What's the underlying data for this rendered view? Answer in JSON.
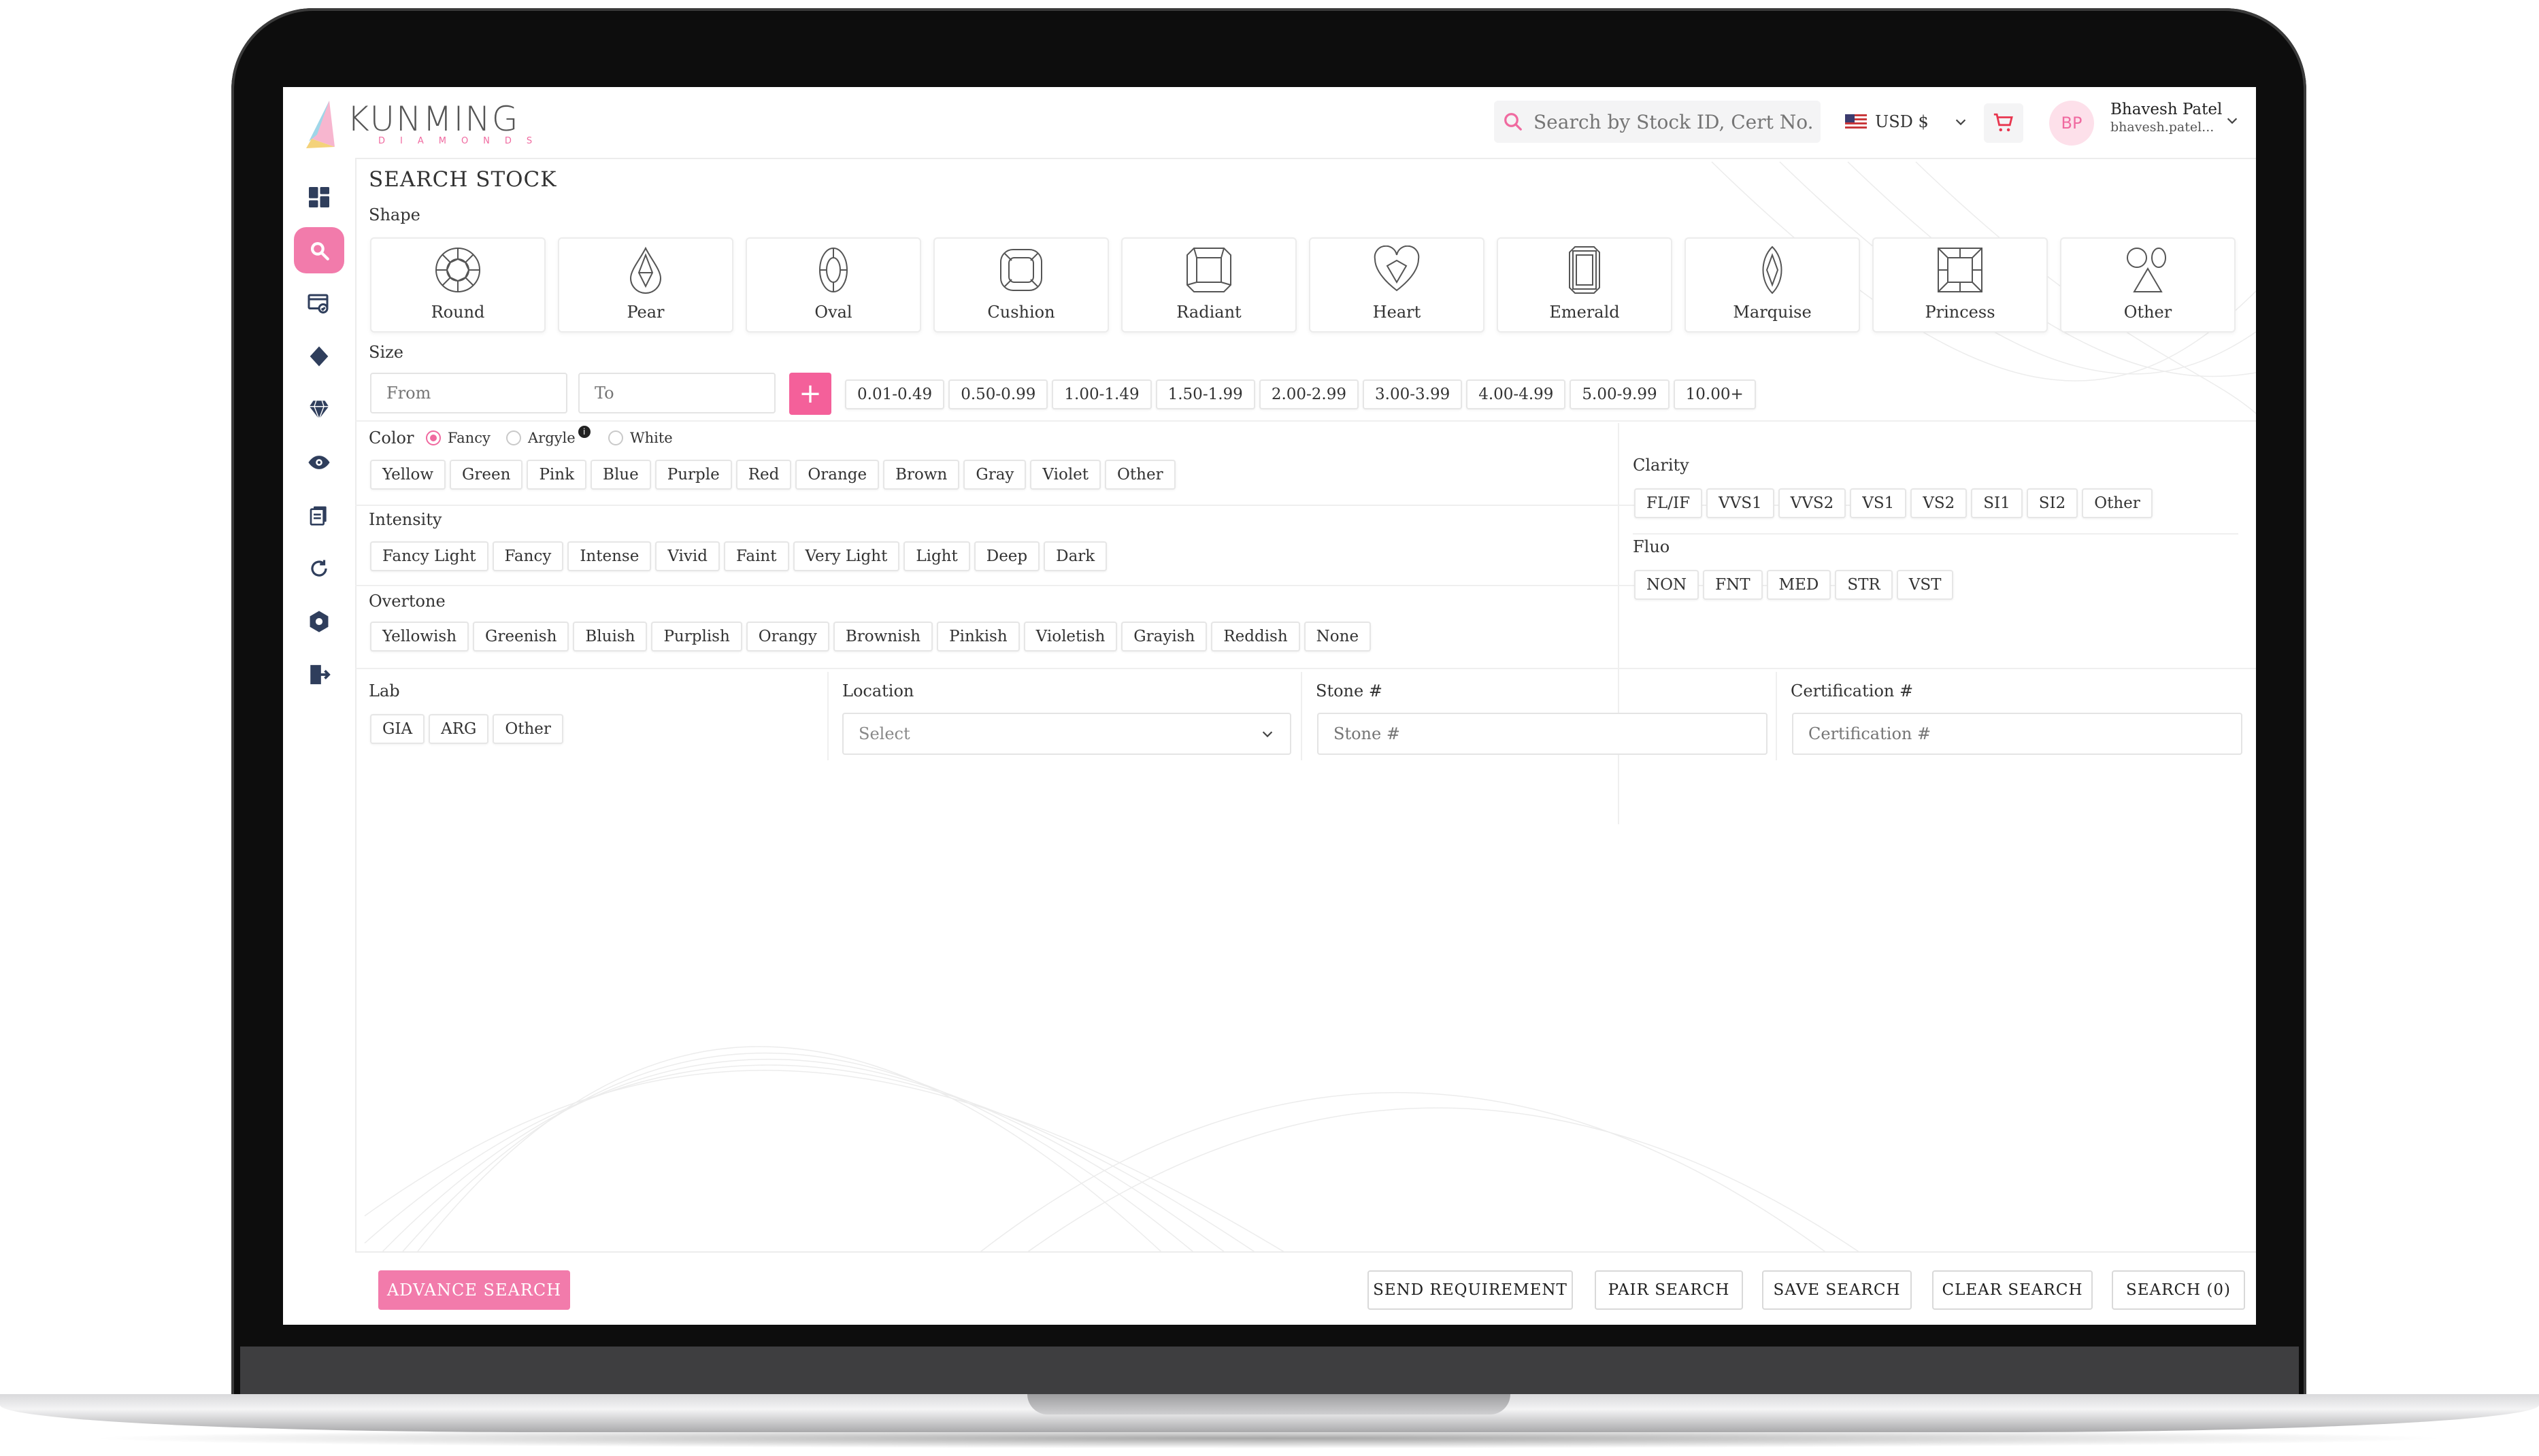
{
  "app": {
    "logo_name": "KUNMING",
    "logo_sub": "DIAMONDS"
  },
  "header": {
    "search_placeholder": "Search by Stock ID, Cert No.",
    "currency": "USD $",
    "avatar_initials": "BP",
    "user_name": "Bhavesh Patel",
    "user_email": "bhavesh.patel..."
  },
  "sidebar": {
    "icons": [
      "dashboard-icon",
      "search-icon",
      "cart-list-icon",
      "diamond-icon",
      "gem-icon",
      "eye-icon",
      "documents-icon",
      "refresh-icon",
      "settings-icon",
      "logout-icon",
      "menu-icon"
    ],
    "active": "search-icon"
  },
  "page": {
    "title": "SEARCH STOCK",
    "shape_label": "Shape",
    "size_label": "Size",
    "color_label": "Color",
    "intensity_label": "Intensity",
    "overtone_label": "Overtone",
    "clarity_label": "Clarity",
    "fluo_label": "Fluo",
    "lab_label": "Lab",
    "location_label": "Location",
    "stone_label": "Stone #",
    "cert_label": "Certification #"
  },
  "shapes": [
    "Round",
    "Pear",
    "Oval",
    "Cushion",
    "Radiant",
    "Heart",
    "Emerald",
    "Marquise",
    "Princess",
    "Other"
  ],
  "size": {
    "from_placeholder": "From",
    "to_placeholder": "To",
    "add_label": "+",
    "ranges": [
      "0.01-0.49",
      "0.50-0.99",
      "1.00-1.49",
      "1.50-1.99",
      "2.00-2.99",
      "3.00-3.99",
      "4.00-4.99",
      "5.00-9.99",
      "10.00+"
    ]
  },
  "color_modes": {
    "options": [
      "Fancy",
      "Argyle",
      "White"
    ],
    "selected": "Fancy",
    "info": "i"
  },
  "colors": [
    "Yellow",
    "Green",
    "Pink",
    "Blue",
    "Purple",
    "Red",
    "Orange",
    "Brown",
    "Gray",
    "Violet",
    "Other"
  ],
  "intensities": [
    "Fancy Light",
    "Fancy",
    "Intense",
    "Vivid",
    "Faint",
    "Very Light",
    "Light",
    "Deep",
    "Dark"
  ],
  "overtones": [
    "Yellowish",
    "Greenish",
    "Bluish",
    "Purplish",
    "Orangy",
    "Brownish",
    "Pinkish",
    "Violetish",
    "Grayish",
    "Reddish",
    "None"
  ],
  "clarity": [
    "FL/IF",
    "VVS1",
    "VVS2",
    "VS1",
    "VS2",
    "SI1",
    "SI2",
    "Other"
  ],
  "fluo": [
    "NON",
    "FNT",
    "MED",
    "STR",
    "VST"
  ],
  "labs": [
    "GIA",
    "ARG",
    "Other"
  ],
  "location": {
    "placeholder": "Select"
  },
  "stone": {
    "placeholder": "Stone #"
  },
  "cert": {
    "placeholder": "Certification #"
  },
  "actions": {
    "advance": "ADVANCE SEARCH",
    "send_requirement": "SEND REQUIREMENT",
    "pair_search": "PAIR SEARCH",
    "save_search": "SAVE SEARCH",
    "clear_search": "CLEAR SEARCH",
    "search": "SEARCH (0)"
  },
  "colors_theme": {
    "accent": "#f27bab",
    "accent_dark": "#f4609a",
    "border": "#e6e6e6"
  }
}
